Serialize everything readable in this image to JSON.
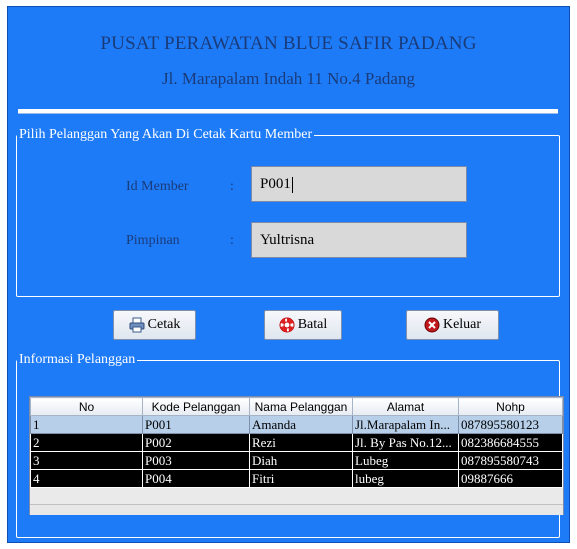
{
  "header": {
    "title": "PUSAT PERAWATAN BLUE SAFIR PADANG",
    "address": "Jl. Marapalam Indah 11 No.4 Padang"
  },
  "form": {
    "legend": "Pilih Pelanggan Yang Akan Di Cetak Kartu Member",
    "id_label": "Id Member",
    "id_colon": ":",
    "id_value": "P001",
    "pimpinan_label": "Pimpinan",
    "pimpinan_colon": ":",
    "pimpinan_value": "Yultrisna"
  },
  "buttons": {
    "cetak": "Cetak",
    "batal": "Batal",
    "keluar": "Keluar"
  },
  "info": {
    "legend": "Informasi Pelanggan",
    "columns": [
      "No",
      "Kode Pelanggan",
      "Nama Pelanggan",
      "Alamat",
      "Nohp"
    ],
    "rows": [
      [
        "1",
        "P001",
        "Amanda",
        "Jl.Marapalam In...",
        "087895580123"
      ],
      [
        "2",
        "P002",
        "Rezi",
        "Jl. By Pas No.12...",
        "082386684555"
      ],
      [
        "3",
        "P003",
        "Diah",
        "Lubeg",
        "087895580743"
      ],
      [
        "4",
        "P004",
        "Fitri",
        "lubeg",
        "09887666"
      ]
    ]
  },
  "colors": {
    "window_bg": "#1e7bf7",
    "title_text": "#1a3b7a",
    "selected_row": "#b7cfe9",
    "dark_row": "#000000"
  },
  "icons": {
    "cetak": "printer-icon",
    "batal": "lifebuoy-icon",
    "keluar": "close-circle-icon"
  }
}
